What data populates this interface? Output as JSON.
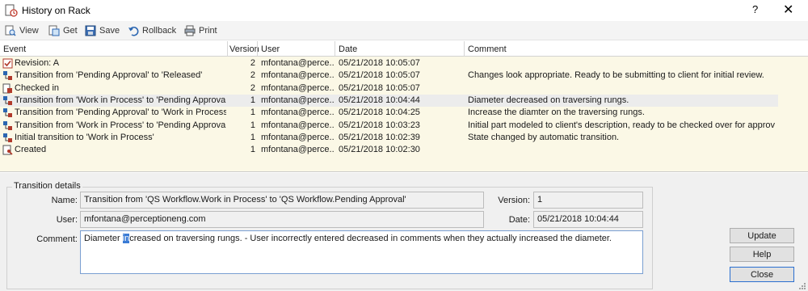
{
  "window": {
    "title": "History on Rack",
    "help_label": "?",
    "close_label": "✕"
  },
  "toolbar": {
    "view": "View",
    "get": "Get",
    "save": "Save",
    "rollback": "Rollback",
    "print": "Print"
  },
  "grid": {
    "columns": {
      "event": "Event",
      "version": "Version",
      "user": "User",
      "date": "Date",
      "comment": "Comment"
    },
    "rows": [
      {
        "icon": "revision-check-icon",
        "event": "Revision: A",
        "version": "2",
        "user": "mfontana@perce...",
        "date": "05/21/2018 10:05:07",
        "comment": ""
      },
      {
        "icon": "transition-icon",
        "event": "Transition from 'Pending Approval' to 'Released'",
        "version": "2",
        "user": "mfontana@perce...",
        "date": "05/21/2018 10:05:07",
        "comment": "Changes look appropriate. Ready to be submitting to client for initial review."
      },
      {
        "icon": "checked-in-icon",
        "event": "Checked in",
        "version": "2",
        "user": "mfontana@perce...",
        "date": "05/21/2018 10:05:07",
        "comment": ""
      },
      {
        "icon": "transition-icon",
        "event": "Transition from 'Work in Process' to 'Pending Approval'",
        "version": "1",
        "user": "mfontana@perce...",
        "date": "05/21/2018 10:04:44",
        "comment": "Diameter decreased on traversing rungs."
      },
      {
        "icon": "transition-icon",
        "event": "Transition from 'Pending Approval' to 'Work in Process'",
        "version": "1",
        "user": "mfontana@perce...",
        "date": "05/21/2018 10:04:25",
        "comment": "Increase the diamter on the traversing rungs."
      },
      {
        "icon": "transition-icon",
        "event": "Transition from 'Work in Process' to 'Pending Approval'",
        "version": "1",
        "user": "mfontana@perce...",
        "date": "05/21/2018 10:03:23",
        "comment": "Initial part modeled to client's description, ready to be checked over for approval."
      },
      {
        "icon": "transition-icon",
        "event": "Initial transition to 'Work in Process'",
        "version": "1",
        "user": "mfontana@perce...",
        "date": "05/21/2018 10:02:39",
        "comment": "State changed by automatic transition."
      },
      {
        "icon": "created-icon",
        "event": "Created",
        "version": "1",
        "user": "mfontana@perce...",
        "date": "05/21/2018 10:02:30",
        "comment": ""
      }
    ]
  },
  "details": {
    "group_title": "Transition details",
    "name_label": "Name:",
    "name_value": "Transition from 'QS Workflow.Work in Process' to 'QS Workflow.Pending Approval'",
    "version_label": "Version:",
    "version_value": "1",
    "user_label": "User:",
    "user_value": "mfontana@perceptioneng.com",
    "date_label": "Date:",
    "date_value": "05/21/2018 10:04:44",
    "comment_label": "Comment:",
    "comment_before": "Diameter ",
    "comment_selected": "in",
    "comment_after": "creased on traversing rungs. - User incorrectly entered decreased in comments when they actually increased the diameter."
  },
  "buttons": {
    "update": "Update",
    "help": "Help",
    "close": "Close"
  }
}
